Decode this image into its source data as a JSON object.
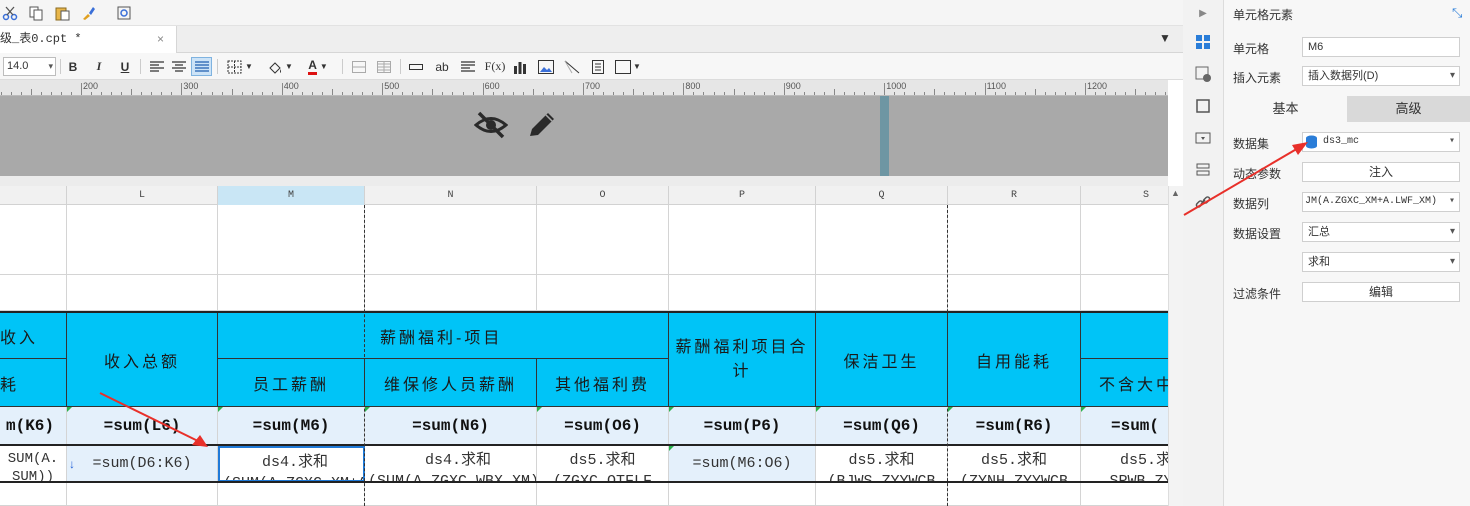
{
  "tab": {
    "title": "级_表0.cpt *",
    "close": "×"
  },
  "format": {
    "font_size": "14.0",
    "bold": "B",
    "italic": "I",
    "underline": "U",
    "ab": "ab",
    "fx": "F(x)",
    "font_color_glyph": "A"
  },
  "ruler": {
    "ticks": [
      "200",
      "300",
      "400",
      "500",
      "600",
      "700",
      "800",
      "900",
      "1000",
      "1100",
      "1200"
    ]
  },
  "columns": {
    "L": "L",
    "M": "M",
    "N": "N",
    "O": "O",
    "P": "P",
    "Q": "Q",
    "R": "R",
    "S": "S"
  },
  "cells": {
    "k_head1": "收入",
    "k_head2": "耗",
    "l_merged": "收入总额",
    "mno_head": "薪酬福利-项目",
    "m_head": "员工薪酬",
    "n_head": "维保修人员薪酬",
    "o_head": "其他福利费",
    "p_head": "薪酬福利项目合计",
    "q_head": "保洁卫生",
    "r_head": "自用能耗",
    "s_head": "不含大中",
    "k_sum": "m(K6)",
    "l_sum": "=sum(L6)",
    "m_sum": "=sum(M6)",
    "n_sum": "=sum(N6)",
    "o_sum": "=sum(O6)",
    "p_sum": "=sum(P6)",
    "q_sum": "=sum(Q6)",
    "r_sum": "=sum(R6)",
    "s_sum": "=sum(",
    "k_data": "SUM(A. SUM))",
    "l_data": "=sum(D6:K6)",
    "m_data": "ds4.求和(SUM(A.ZGXC_XM+A",
    "n_data": "ds4.求和(SUM(A.ZGXC_WBX_XM))",
    "o_data": "ds5.求和(ZGXC_QTFLF",
    "p_data": "=sum(M6:O6)",
    "q_data": "ds5.求和(BJWS_ZYYWCB",
    "r_data": "ds5.求和(ZYNH_ZYYWCB",
    "s_data": "ds5.求 SRWB_ZYY"
  },
  "panel": {
    "title": "单元格元素",
    "cell_label": "单元格",
    "cell_value": "M6",
    "insert_label": "插入元素",
    "insert_value": "插入数据列(D)",
    "tab_basic": "基本",
    "tab_advanced": "高级",
    "dataset_label": "数据集",
    "dataset_value": "ds3_mc",
    "dynparam_label": "动态参数",
    "dynparam_button": "注入",
    "column_label": "数据列",
    "column_value": "JM(A.ZGXC_XM+A.LWF_XM)",
    "setting_label": "数据设置",
    "setting_value": "汇总",
    "agg_value": "求和",
    "filter_label": "过滤条件",
    "filter_button": "编辑"
  },
  "colors": {
    "header_cyan": "#00c4f7",
    "selection_blue": "#1f7ad8",
    "annotation_red": "#e8302a"
  }
}
